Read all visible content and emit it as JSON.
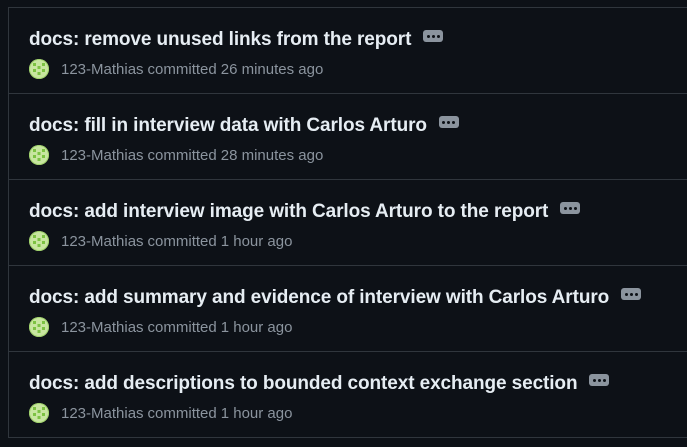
{
  "commits": [
    {
      "title": "docs: remove unused links from the report",
      "author": "123-Mathias",
      "action": "committed",
      "time": "26 minutes ago"
    },
    {
      "title": "docs: fill in interview data with Carlos Arturo",
      "author": "123-Mathias",
      "action": "committed",
      "time": "28 minutes ago"
    },
    {
      "title": "docs: add interview image with Carlos Arturo to the report",
      "author": "123-Mathias",
      "action": "committed",
      "time": "1 hour ago"
    },
    {
      "title": "docs: add summary and evidence of interview with Carlos Arturo",
      "author": "123-Mathias",
      "action": "committed",
      "time": "1 hour ago"
    },
    {
      "title": "docs: add descriptions to bounded context exchange section",
      "author": "123-Mathias",
      "action": "committed",
      "time": "1 hour ago"
    }
  ],
  "colors": {
    "background": "#0d1117",
    "border": "#30363d",
    "title": "#e6edf3",
    "muted": "#8b949e",
    "avatar": "#9fd26a"
  },
  "icons": {
    "ellipsis": "kebab-horizontal-icon",
    "avatar": "identicon-avatar"
  }
}
